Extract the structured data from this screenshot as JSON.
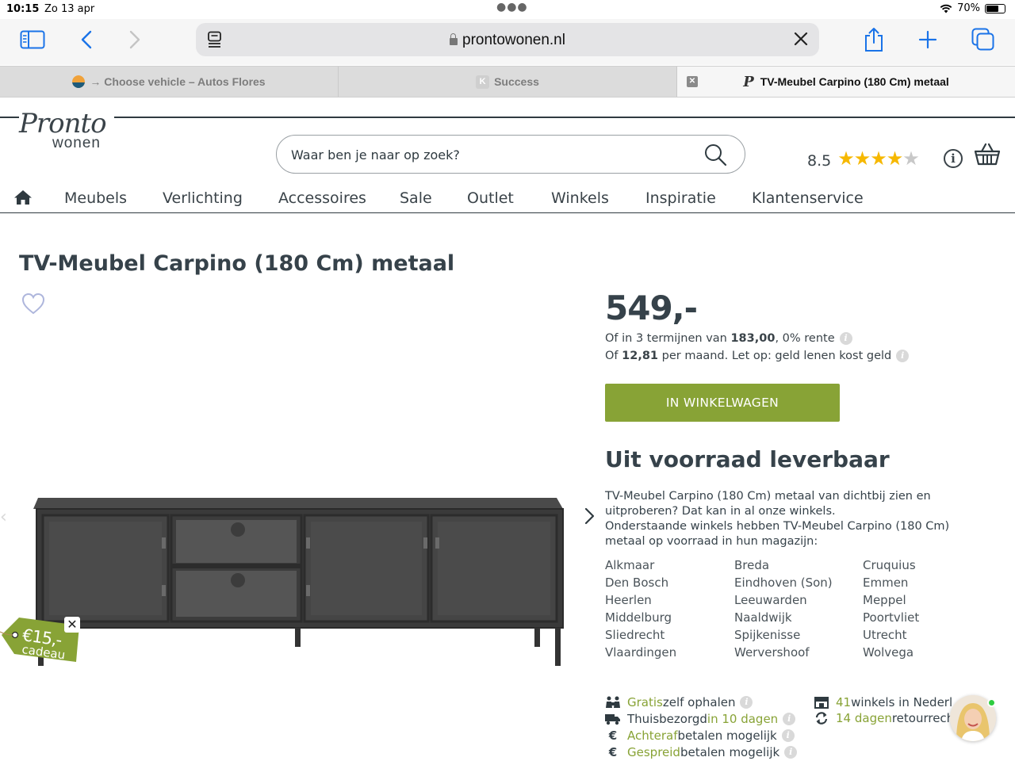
{
  "status": {
    "time": "10:15",
    "date": "Zo 13 apr",
    "battery": "70%",
    "battery_fraction": 0.7
  },
  "browser": {
    "url": "prontowonen.nl",
    "tabs": [
      {
        "label": "→ Choose vehicle – Autos Flores",
        "active": false
      },
      {
        "label": "Success",
        "active": false
      },
      {
        "label": "TV-Meubel Carpino (180 Cm) metaal",
        "active": true
      }
    ]
  },
  "site": {
    "logo_top": "Pronto",
    "logo_bottom": "wonen",
    "search_placeholder": "Waar ben je naar op zoek?",
    "rating": "8.5",
    "rating_stars": 4,
    "rating_max": 5,
    "colors": {
      "accent": "#88a336",
      "text": "#36424a",
      "star": "#f6b800"
    },
    "nav": [
      "Meubels",
      "Verlichting",
      "Accessoires",
      "Sale",
      "Outlet",
      "Winkels",
      "Inspiratie",
      "Klantenservice"
    ]
  },
  "product": {
    "title": "TV-Meubel Carpino (180 Cm) metaal",
    "price": "549,-",
    "termijn_pre": "Of in 3 termijnen van ",
    "termijn_amount": "183,00",
    "termijn_post": ", 0% rente",
    "maand_pre": "Of ",
    "maand_amount": "12,81",
    "maand_post": " per maand. Let op: geld lenen kost geld",
    "cart_button": "IN WINKELWAGEN",
    "gift_amount": "€15,-",
    "gift_label": "cadeau",
    "stock_title": "Uit voorraad leverbaar",
    "stock_desc_1": "TV-Meubel Carpino (180 Cm) metaal van dichtbij zien en uitproberen? Dat kan in al onze winkels.",
    "stock_desc_2": "Onderstaande winkels hebben TV-Meubel Carpino (180 Cm) metaal op voorraad in hun magazijn:",
    "stores": [
      "Alkmaar",
      "Breda",
      "Cruquius",
      "Den Bosch",
      "Eindhoven (Son)",
      "Emmen",
      "Heerlen",
      "Leeuwarden",
      "Meppel",
      "Middelburg",
      "Naaldwijk",
      "Poortvliet",
      "Sliedrecht",
      "Spijkenisse",
      "Utrecht",
      "Vlaardingen",
      "Wervershoof",
      "Wolvega"
    ]
  },
  "usps": {
    "ophalen_g": "Gratis",
    "ophalen_t": " zelf ophalen",
    "thuis_t": "Thuisbezorgd ",
    "thuis_g": "in 10 dagen",
    "achteraf_g": "Achteraf",
    "achteraf_t": " betalen mogelijk",
    "gespreid_g": "Gespreid",
    "gespreid_t": " betalen mogelijk",
    "winkels_g": "41",
    "winkels_t": " winkels in Nederl",
    "retour_g": "14 dagen",
    "retour_t": " retourrech",
    "euro_symbol": "€"
  }
}
